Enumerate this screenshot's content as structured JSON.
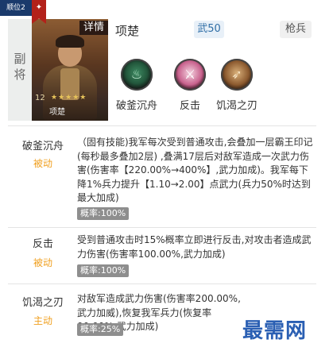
{
  "hero": {
    "rank_badge": "顺位2",
    "detail_button": "详情",
    "role": "副将",
    "level": "12",
    "stars": "★★★★★",
    "portrait_name": "项楚",
    "name": "项楚",
    "attribute_tag": "武50",
    "troop_tag": "枪兵"
  },
  "skill_icons": [
    {
      "label": "破釜沉舟",
      "icon": "pot-icon",
      "color": "#2f7a55"
    },
    {
      "label": "反击",
      "icon": "counter-icon",
      "color": "#c8618d"
    },
    {
      "label": "饥渴之刃",
      "icon": "blade-icon",
      "color": "#8c5a2f"
    }
  ],
  "skills": [
    {
      "name": "破釜沉舟",
      "type": "被动",
      "desc": "（固有技能)我军每次受到普通攻击,会叠加一层霸王印记(每秒最多叠加2层) ,叠满17层后对敌军造成一次武力伤害(伤害率【220.00%→400%】,武力加成)。我军每下降1%兵力提升【1.10→2.00】点武力(兵力50%时达到最大加成)",
      "prob": "概率:100%"
    },
    {
      "name": "反击",
      "type": "被动",
      "desc": "受到普通攻击时15%概率立即进行反击,对攻击者造成武力伤害(伤害率100.00%,武力加成)",
      "prob": "概率:100%"
    },
    {
      "name": "饥渴之刃",
      "type": "主动",
      "desc": "对敌军造成武力伤害(伤害率200.00%,武力加威),恢复我军兵力(恢复率90.00%,武力加成)",
      "prob": "概率:25%"
    }
  ],
  "watermark": "最需网",
  "colors": {
    "passive": "#f0a020",
    "active": "#f0a020",
    "attr_tag": "#2f6ea6",
    "prob_bg": "#8e8e8e"
  }
}
